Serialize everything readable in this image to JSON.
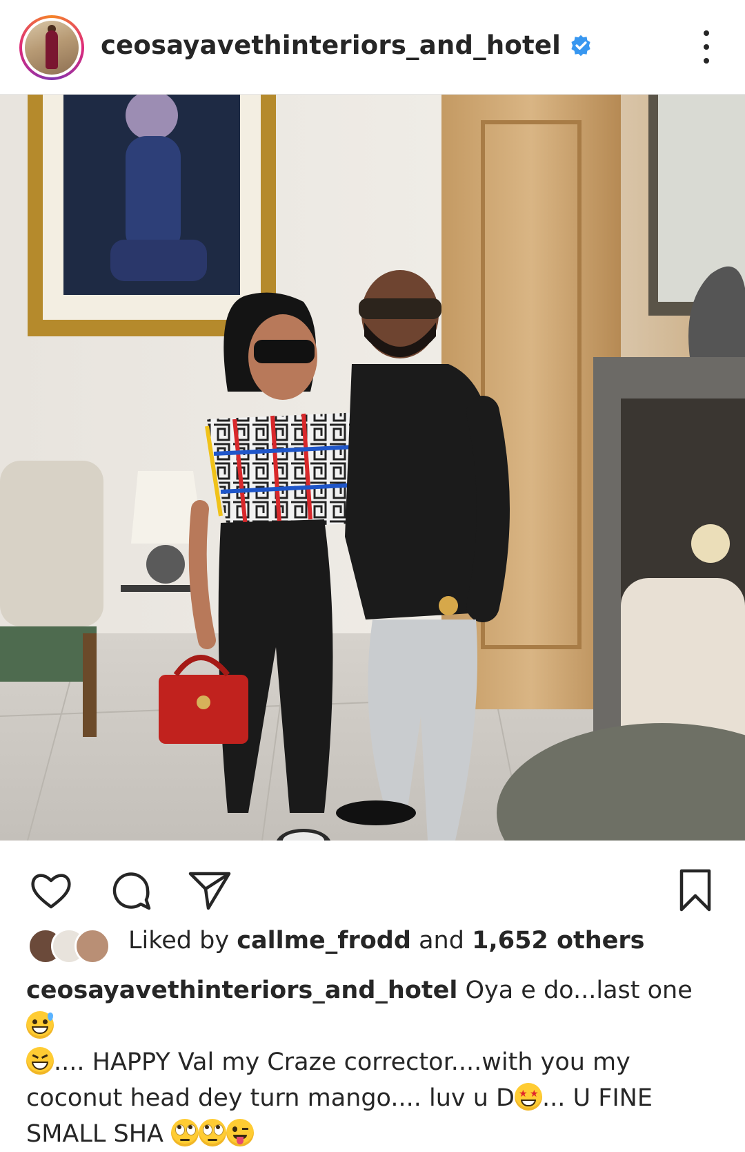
{
  "post": {
    "username": "ceosayavethinteriors_and_hotel",
    "verified": true
  },
  "likes": {
    "prefix": "Liked by",
    "user": "callme_frodd",
    "connector": "and",
    "others": "1,652 others"
  },
  "caption": {
    "author": "ceosayavethinteriors_and_hotel",
    "part1": " Oya e do...last one ",
    "part2": ".... HAPPY Val my Craze corrector....with you my coconut head dey turn mango.... luv u D",
    "part3": "... U FINE SMALL SHA "
  },
  "icons": {
    "like": "heart-icon",
    "comment": "comment-bubble-icon",
    "share": "paper-plane-icon",
    "save": "bookmark-icon",
    "more": "vertical-dots-icon",
    "verified": "verified-badge-icon"
  },
  "colors": {
    "verified": "#3897f0",
    "text": "#262626"
  }
}
